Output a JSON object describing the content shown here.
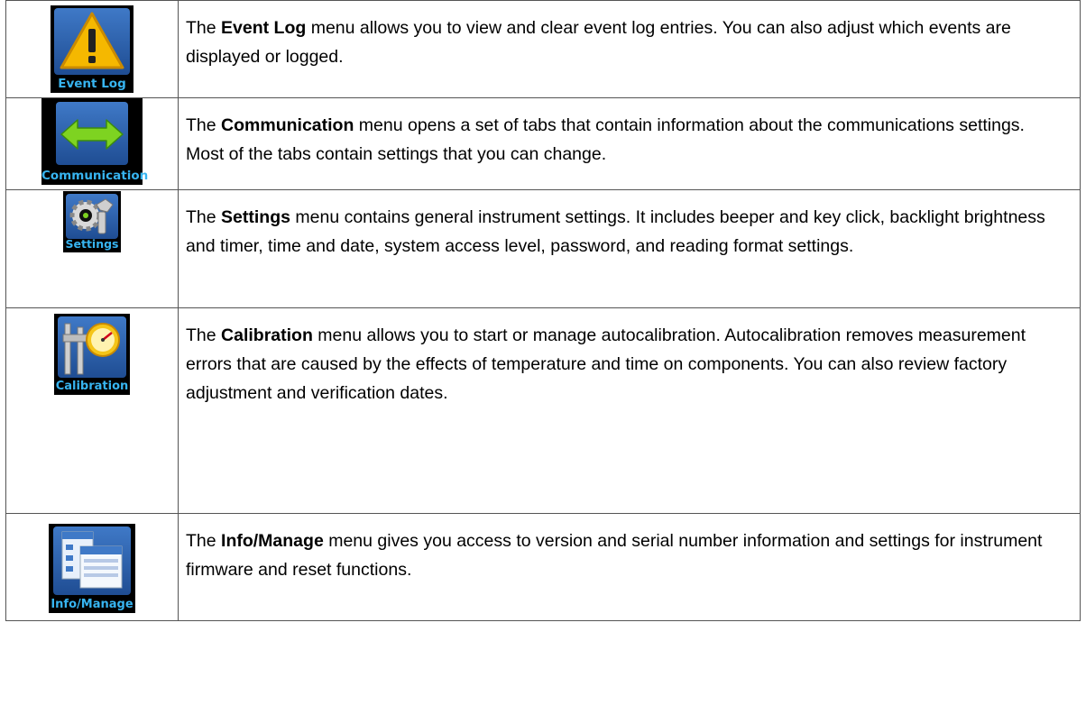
{
  "rows": [
    {
      "icon_name": "warning-icon",
      "icon_caption": "Event Log",
      "bold": "Event Log",
      "text": " menu allows you to view and clear event log entries. You can also adjust which events are displayed or logged."
    },
    {
      "icon_name": "double-arrow-icon",
      "icon_caption": "Communication",
      "bold": "Communication",
      "text": " menu opens a set of tabs that contain information about the communications settings. Most of the tabs contain settings that you can change."
    },
    {
      "icon_name": "gear-wrench-icon",
      "icon_caption": "Settings",
      "bold": "Settings",
      "text": " menu contains general instrument settings. It includes beeper and key click, backlight brightness and timer, time and date, system access level, password, and reading format settings."
    },
    {
      "icon_name": "caliper-gauge-icon",
      "icon_caption": "Calibration",
      "bold": "Calibration",
      "text": " menu allows you to start or manage autocalibration. Autocalibration removes measurement errors that are caused by the effects of temperature and time on components. You can also review factory adjustment and verification dates."
    },
    {
      "icon_name": "windows-icon",
      "icon_caption": "Info/Manage",
      "bold": "Info/Manage",
      "text": " menu gives you access to version and serial number information and settings for instrument firmware and reset functions."
    }
  ],
  "article": "The",
  "colors": {
    "icon_bg": "#000000",
    "caption": "#37b4f0",
    "tile": "#2f62ad",
    "warning": "#f5b800",
    "arrow": "#7ed321"
  }
}
